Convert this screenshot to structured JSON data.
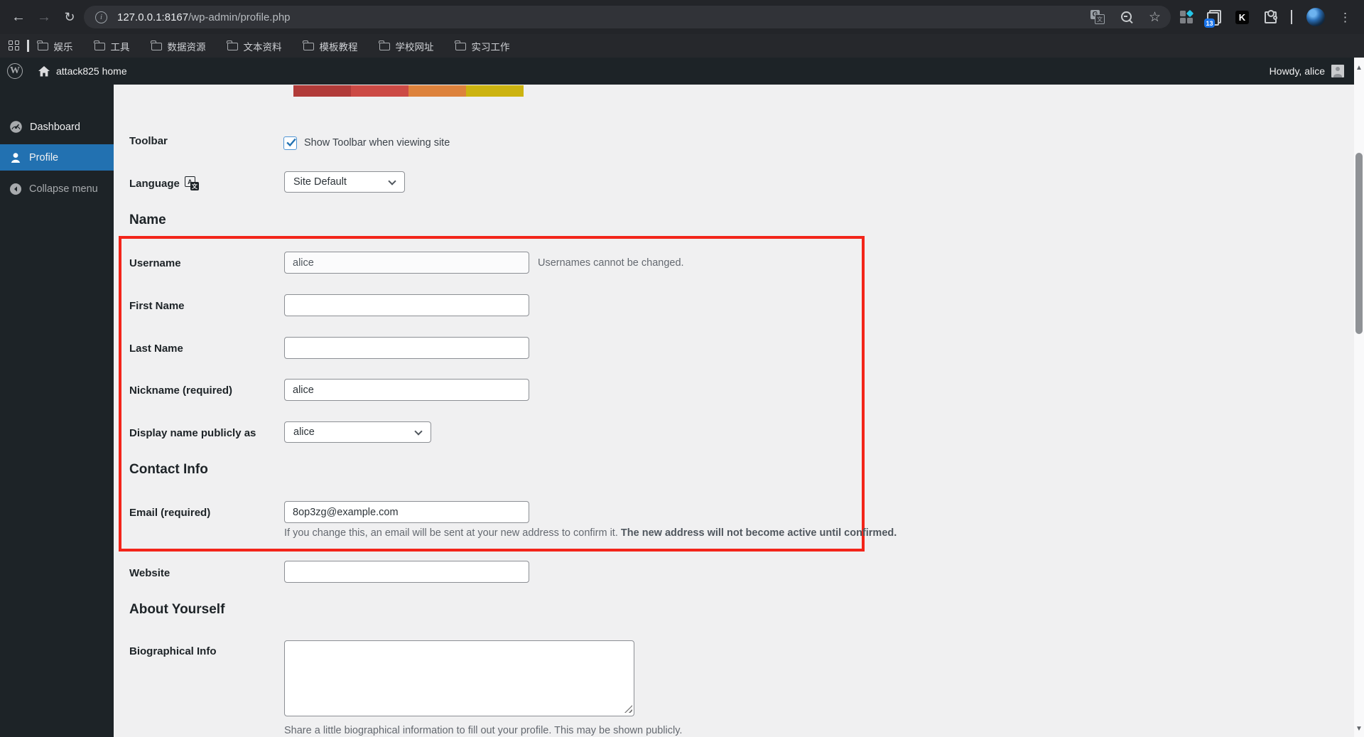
{
  "browser": {
    "url": {
      "host": "127.0.0.1:8167",
      "path": "/wp-admin/profile.php"
    },
    "bookmarks": [
      "娱乐",
      "工具",
      "数据资源",
      "文本资料",
      "模板教程",
      "学校网址",
      "实习工作"
    ],
    "extensions": {
      "tab_badge": "13",
      "k_label": "K"
    }
  },
  "admin_bar": {
    "site": "attack825 home",
    "howdy": "Howdy, alice"
  },
  "sidebar": {
    "dashboard": "Dashboard",
    "profile": "Profile",
    "collapse": "Collapse menu"
  },
  "page": {
    "toolbar_label": "Toolbar",
    "toolbar_checkbox_label": "Show Toolbar when viewing site",
    "language_label": "Language",
    "language_value": "Site Default",
    "name_heading": "Name",
    "username_label": "Username",
    "username_value": "alice",
    "username_note": "Usernames cannot be changed.",
    "first_name_label": "First Name",
    "last_name_label": "Last Name",
    "nickname_label": "Nickname (required)",
    "nickname_value": "alice",
    "display_name_label": "Display name publicly as",
    "display_name_value": "alice",
    "contact_heading": "Contact Info",
    "email_label": "Email (required)",
    "email_value": "8op3zg@example.com",
    "email_desc_normal": "If you change this, an email will be sent at your new address to confirm it. ",
    "email_desc_bold": "The new address will not become active until confirmed.",
    "website_label": "Website",
    "about_heading": "About Yourself",
    "bio_label": "Biographical Info",
    "bio_desc": "Share a little biographical information to fill out your profile. This may be shown publicly."
  },
  "colors": {
    "accent_blue": "#2271b1",
    "highlight_red": "#f3251a",
    "strip": [
      "#b13b39",
      "#cc4a45",
      "#dd823c",
      "#ccb310"
    ]
  }
}
